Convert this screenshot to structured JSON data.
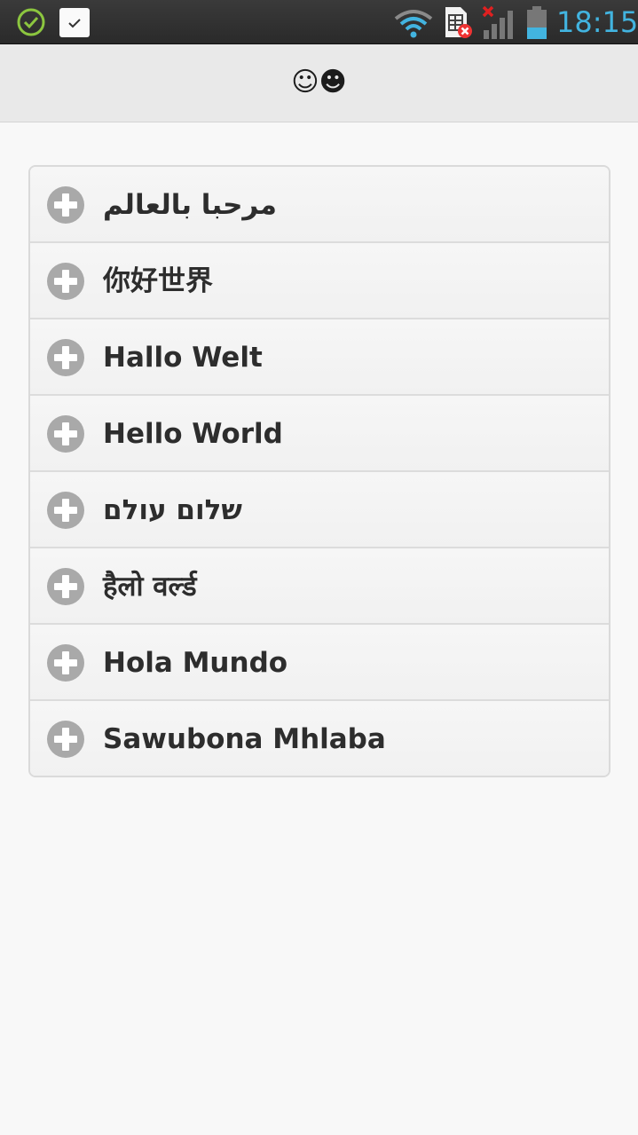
{
  "status_bar": {
    "time": "18:15",
    "icons": [
      "check-circle-icon",
      "task-check-icon",
      "wifi-icon",
      "sim-error-icon",
      "signal-off-icon",
      "battery-icon"
    ],
    "time_color": "#42b4e0"
  },
  "header": {
    "title": "☺☻"
  },
  "list": {
    "items": [
      {
        "label": "مرحبا بالعالم",
        "icon": "plus-circle-icon"
      },
      {
        "label": "你好世界",
        "icon": "plus-circle-icon"
      },
      {
        "label": "Hallo Welt",
        "icon": "plus-circle-icon"
      },
      {
        "label": "Hello World",
        "icon": "plus-circle-icon"
      },
      {
        "label": "שלום עולם",
        "icon": "plus-circle-icon"
      },
      {
        "label": "हैलो वर्ल्ड",
        "icon": "plus-circle-icon"
      },
      {
        "label": "Hola Mundo",
        "icon": "plus-circle-icon"
      },
      {
        "label": "Sawubona Mhlaba",
        "icon": "plus-circle-icon"
      }
    ]
  },
  "colors": {
    "status_bar_bg": "#2e2e2e",
    "header_bg": "#e9e9e9",
    "page_bg": "#f8f8f8",
    "plus_icon": "#a9a9a9",
    "accent_green": "#8cc63f"
  }
}
